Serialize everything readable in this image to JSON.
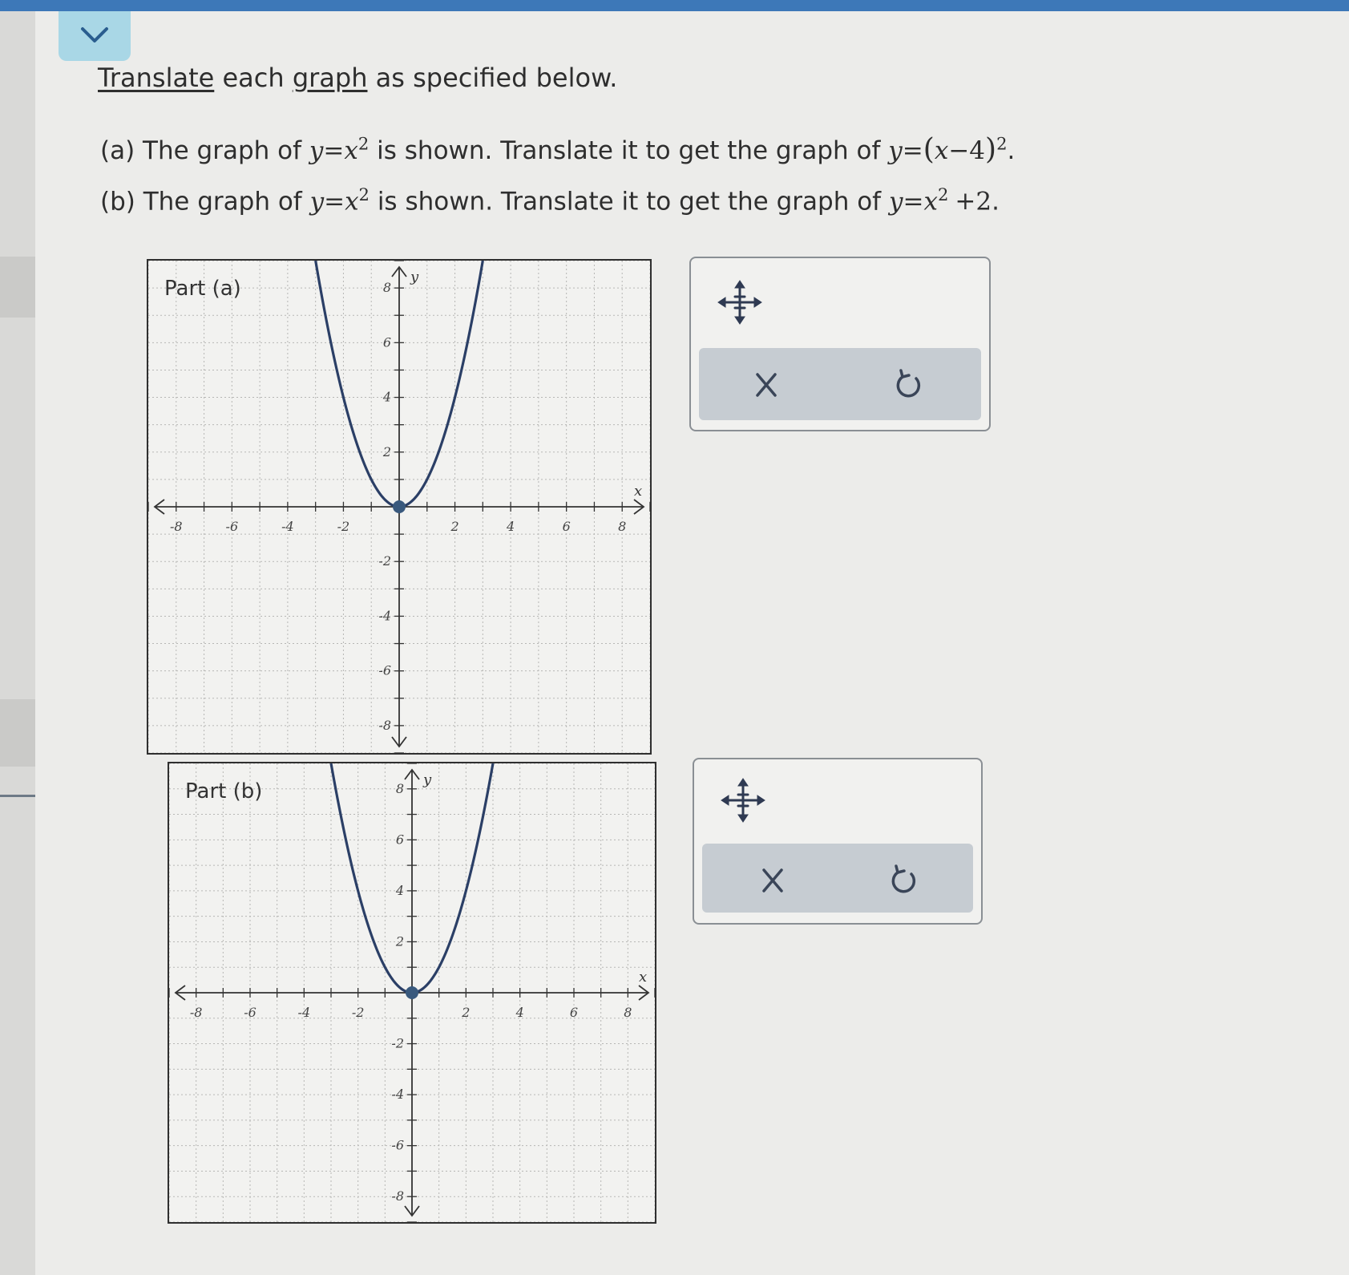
{
  "header": {
    "collapse_icon": "chevron-down-icon"
  },
  "instructions": {
    "verb": "Translate",
    "each": " each ",
    "graph_word": "graph",
    "rest": " as specified below."
  },
  "part_a": {
    "prefix": "(a) The graph of ",
    "base_eq": {
      "y": "y",
      "eq": "=",
      "x": "x",
      "exp": "2"
    },
    "middle": " is shown. Translate it to get the graph of ",
    "target_eq": {
      "y": "y",
      "eq": "=",
      "lparen": "(",
      "x": "x",
      "minus": "−",
      "num": "4",
      "rparen": ")",
      "exp": "2"
    },
    "end": "."
  },
  "part_b": {
    "prefix": "(b) The graph of ",
    "base_eq": {
      "y": "y",
      "eq": "=",
      "x": "x",
      "exp": "2"
    },
    "middle": " is shown. Translate it to get the graph of ",
    "target_eq": {
      "y": "y",
      "eq": "=",
      "x": "x",
      "exp": "2",
      "plus": "+",
      "num": "2"
    },
    "end": "."
  },
  "graphs": [
    {
      "label": "Part (a)",
      "x_axis_label": "x",
      "y_axis_label": "y",
      "x_tick_labels": [
        "-8",
        "-6",
        "-4",
        "-2",
        "2",
        "4",
        "6",
        "8"
      ],
      "y_tick_labels": [
        "8",
        "6",
        "4",
        "2",
        "-2",
        "-4",
        "-6",
        "-8"
      ],
      "xlim": [
        -9,
        9
      ],
      "ylim": [
        -9,
        9
      ],
      "curve": "y = x^2",
      "vertex": [
        0,
        0
      ],
      "curve_color": "#2b3f66",
      "point_color": "#39597d"
    },
    {
      "label": "Part (b)",
      "x_axis_label": "x",
      "y_axis_label": "y",
      "x_tick_labels": [
        "-8",
        "-6",
        "-4",
        "-2",
        "2",
        "4",
        "6",
        "8"
      ],
      "y_tick_labels": [
        "8",
        "6",
        "4",
        "2",
        "-2",
        "-4",
        "-6",
        "-8"
      ],
      "xlim": [
        -9,
        9
      ],
      "ylim": [
        -9,
        9
      ],
      "curve": "y = x^2",
      "vertex": [
        0,
        0
      ],
      "curve_color": "#2b3f66",
      "point_color": "#39597d"
    }
  ],
  "tools": [
    {
      "move_icon": "move-arrows-icon",
      "clear_icon": "close-icon",
      "undo_icon": "undo-icon"
    },
    {
      "move_icon": "move-arrows-icon",
      "clear_icon": "close-icon",
      "undo_icon": "undo-icon"
    }
  ]
}
